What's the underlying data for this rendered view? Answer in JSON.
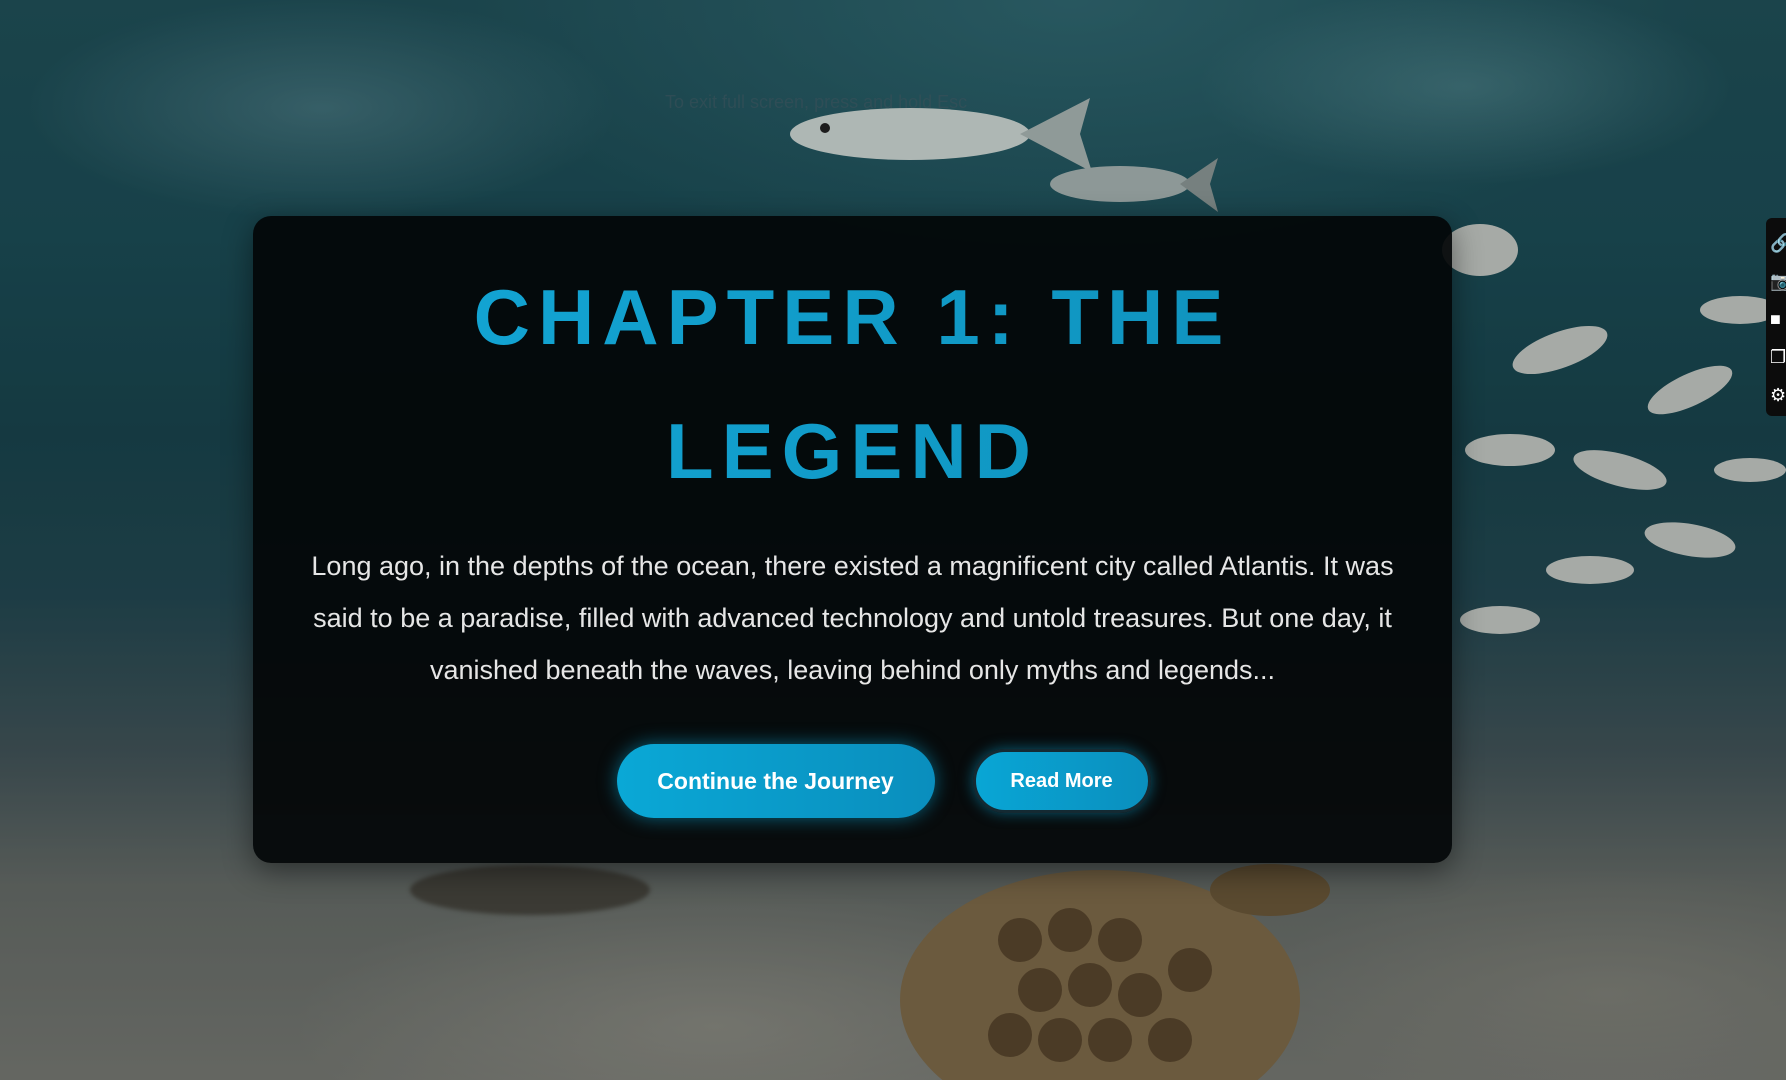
{
  "page": {
    "faint_caption": "To exit full screen, press and hold Esc"
  },
  "card": {
    "title": "CHAPTER 1: THE LEGEND",
    "body": "Long ago, in the depths of the ocean, there existed a magnificent city called Atlantis. It was said to be a paradise, filled with advanced technology and untold treasures. But one day, it vanished beneath the waves, leaving behind only myths and legends...",
    "primary_button": "Continue the Journey",
    "secondary_button": "Read More"
  },
  "tool_strip": {
    "items": [
      {
        "icon": "link-icon",
        "glyph": "🔗"
      },
      {
        "icon": "camera-icon",
        "glyph": "📷"
      },
      {
        "icon": "square-icon",
        "glyph": "■"
      },
      {
        "icon": "copy-icon",
        "glyph": "❐"
      },
      {
        "icon": "gear-icon",
        "glyph": "⚙"
      }
    ]
  },
  "colors": {
    "title": "#129fcb",
    "button": "#0aa8d6",
    "card_bg": "#030608",
    "body_text": "#e6e6e6"
  }
}
